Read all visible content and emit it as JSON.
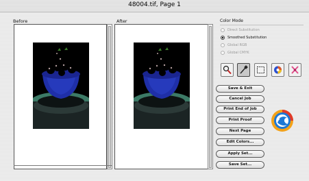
{
  "window": {
    "title": "48004.tif, Page 1"
  },
  "panes": {
    "before_label": "Before",
    "after_label": "After"
  },
  "color_mode": {
    "label": "Color Mode",
    "options": [
      {
        "label": "Direct Substitution",
        "selected": false
      },
      {
        "label": "Smoothed Substitution",
        "selected": true
      },
      {
        "label": "Global RGB",
        "selected": false
      },
      {
        "label": "Global CMYK",
        "selected": false
      }
    ]
  },
  "tools": [
    {
      "icon": "magnifier-icon",
      "active": false
    },
    {
      "icon": "eyedropper-icon",
      "active": true
    },
    {
      "icon": "marquee-icon",
      "active": false
    },
    {
      "icon": "color-wheel-icon",
      "active": false
    },
    {
      "icon": "pin-icon",
      "active": false
    }
  ],
  "buttons": {
    "save_exit": "Save & Exit",
    "cancel_job": "Cancel Job",
    "print_end_of_job": "Print End of Job",
    "print_proof": "Print Proof",
    "next_page": "Next Page",
    "edit_colors": "Edit Colors...",
    "apply_set": "Apply Set...",
    "save_set": "Save Set..."
  },
  "colors": {
    "bowl": "#1f2fa8",
    "berries_before": "#e0304a",
    "berries_after": "#e24838",
    "backdrop_before": "#c77cbf",
    "backdrop_after": "#c877b0"
  }
}
